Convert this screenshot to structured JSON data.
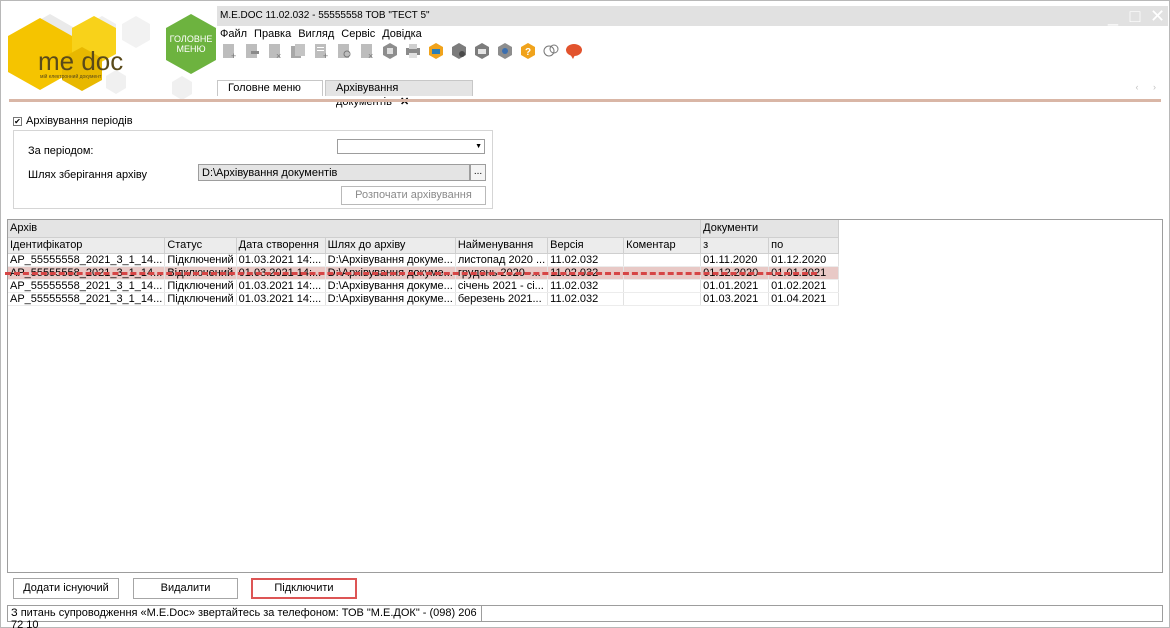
{
  "window": {
    "title": "M.E.DOC 11.02.032  - 55555558 ТОВ \"ТЕСТ 5\"",
    "controls": [
      "_",
      "□",
      "✕"
    ]
  },
  "logo": {
    "brand": "me doc",
    "tagline": "мій електронний документ"
  },
  "main_menu_button": {
    "line1": "ГОЛОВНЕ",
    "line2": "МЕНЮ"
  },
  "menu": [
    "Файл",
    "Правка",
    "Вигляд",
    "Сервіс",
    "Довідка"
  ],
  "toolbar_icons": [
    "new-doc-icon",
    "edit-doc-icon",
    "delete-doc-icon",
    "copy-doc-icon",
    "add-row-icon",
    "view-doc-icon",
    "remove-row-icon",
    "archive-box-icon",
    "print-icon",
    "send-envelope-icon",
    "receive-icon",
    "mail-icon",
    "shield-icon",
    "help-icon",
    "chat-icon",
    "comment-icon"
  ],
  "tabs": [
    {
      "label": "Головне меню",
      "active": false
    },
    {
      "label": "Архівування документів",
      "active": true,
      "close": "✕"
    }
  ],
  "tab_nav": "‹ ›",
  "archiving": {
    "checkbox_label": "Архівування періодів",
    "checked": true,
    "period_label": "За періодом:",
    "period_value": "",
    "path_label": "Шлях зберігання архіву",
    "path_value": "D:\\Архівування документів",
    "browse_label": "...",
    "start_button": "Розпочати архівування"
  },
  "table": {
    "group_headers": {
      "archive": "Архів",
      "documents": "Документи"
    },
    "columns": [
      "Ідентифікатор",
      "Статус",
      "Дата створення",
      "Шлях до архіву",
      "Найменування",
      "Версія",
      "Коментар",
      "з",
      "по"
    ],
    "rows": [
      {
        "id": "AP_55555558_2021_3_1_14...",
        "status": "Підключений",
        "created": "01.03.2021 14:...",
        "path": "D:\\Архівування докуме...",
        "name": "листопад 2020 ...",
        "version": "11.02.032",
        "comment": "",
        "from": "01.11.2020",
        "to": "01.12.2020",
        "selected": false
      },
      {
        "id": "AP_55555558_2021_3_1_14...",
        "status": "Відключений",
        "created": "01.03.2021 14:...",
        "path": "D:\\Архівування докуме...",
        "name": "грудень 2020 -...",
        "version": "11.02.032",
        "comment": "",
        "from": "01.12.2020",
        "to": "01.01.2021",
        "selected": true
      },
      {
        "id": "AP_55555558_2021_3_1_14...",
        "status": "Підключений",
        "created": "01.03.2021 14:...",
        "path": "D:\\Архівування докуме...",
        "name": "січень 2021 - сі...",
        "version": "11.02.032",
        "comment": "",
        "from": "01.01.2021",
        "to": "01.02.2021",
        "selected": false
      },
      {
        "id": "AP_55555558_2021_3_1_14...",
        "status": "Підключений",
        "created": "01.03.2021 14:...",
        "path": "D:\\Архівування докуме...",
        "name": "березень 2021...",
        "version": "11.02.032",
        "comment": "",
        "from": "01.03.2021",
        "to": "01.04.2021",
        "selected": false
      }
    ]
  },
  "buttons": {
    "add_existing": "Додати існуючий",
    "delete": "Видалити",
    "connect": "Підключити"
  },
  "status_bar": {
    "support": "З питань супроводження «M.E.Doc» звертайтесь за телефоном: ТОВ \"М.Е.ДОК\" - (098) 206 72 10",
    "right": ""
  },
  "colors": {
    "accent_logo": "#f5c400",
    "main_menu_green": "#6db33f",
    "selected_row": "#e8c9c6",
    "highlight_red": "#dd5555"
  }
}
